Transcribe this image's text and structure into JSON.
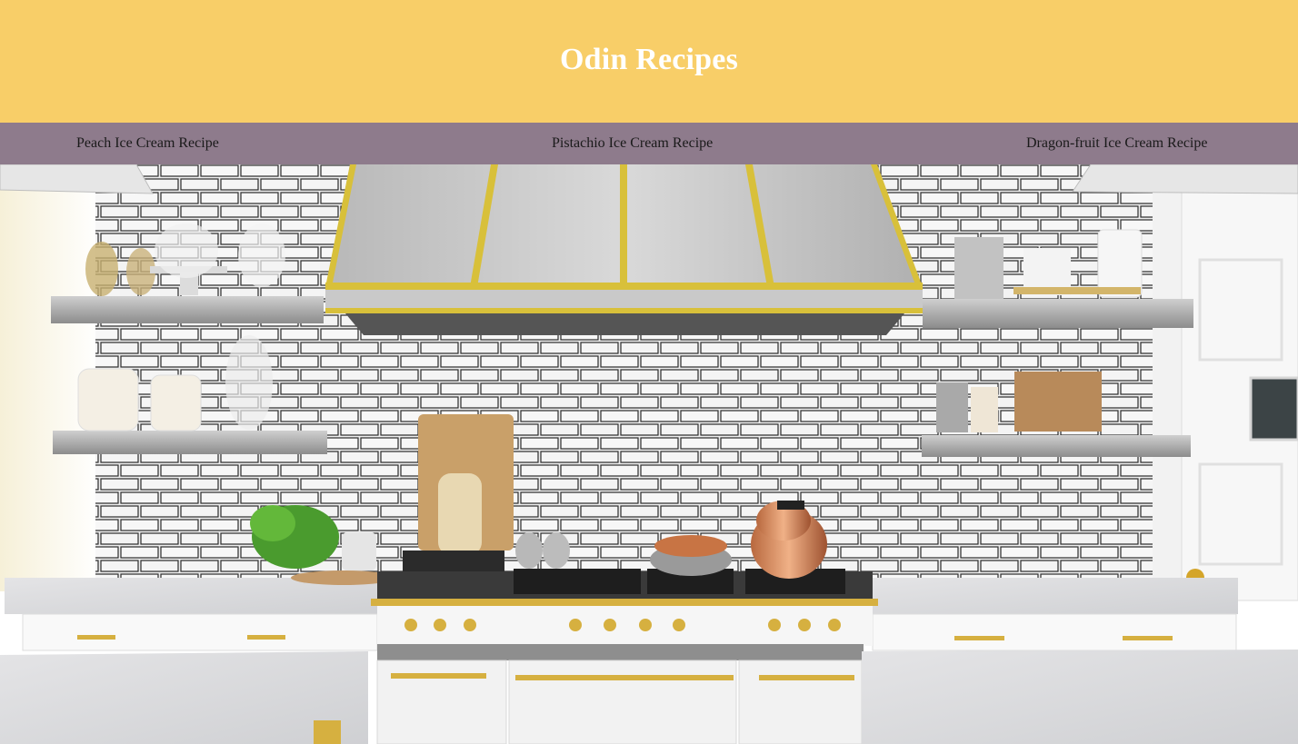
{
  "header": {
    "title": "Odin Recipes",
    "background_color": "#f8ce68",
    "title_color": "#ffffff"
  },
  "nav": {
    "background_color": "#8e7b8c",
    "links": [
      {
        "label": "Peach Ice Cream Recipe"
      },
      {
        "label": "Pistachio Ice Cream Recipe"
      },
      {
        "label": "Dragon-fruit Ice Cream Recipe"
      }
    ]
  },
  "hero": {
    "subject": "white kitchen with subway tile backsplash, brass range hood, stove, and open steel shelves"
  }
}
